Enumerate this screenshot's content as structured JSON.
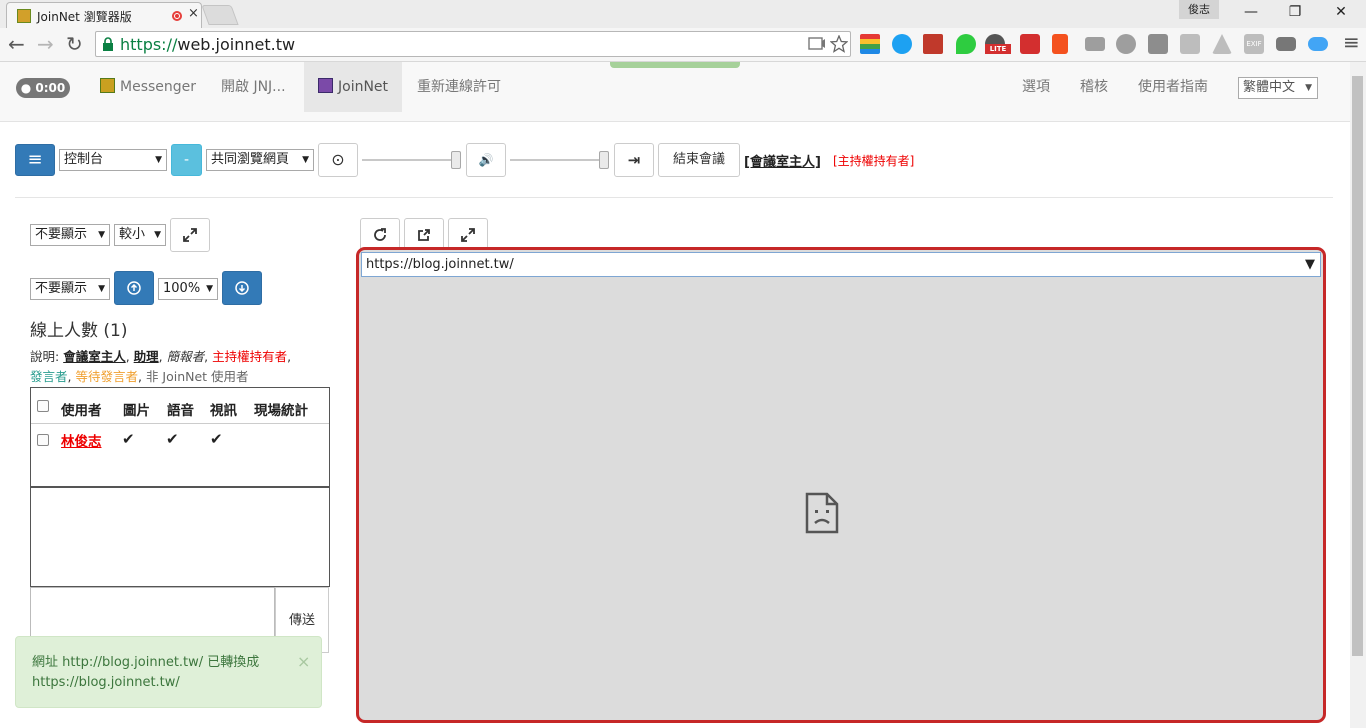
{
  "browser": {
    "tab_title": "JoinNet 瀏覽器版",
    "tab_close": "×",
    "user_chip": "俊志",
    "window_buttons": {
      "minimize": "—",
      "restore": "❐",
      "close": "✕"
    },
    "nav": {
      "back": "←",
      "forward": "→",
      "reload": "↻",
      "menu": "≡"
    },
    "url_scheme": "https://",
    "url_host": "web.joinnet.tw",
    "extensions": [
      "cast-icon",
      "star-icon",
      "colors-icon",
      "skype-icon",
      "book-icon",
      "evernote-icon",
      "lite-icon",
      "adobe-icon",
      "office-icon",
      "chat-icon",
      "m-icon",
      "s-icon",
      "tower-icon",
      "drive-icon",
      "exif-icon",
      "glasses-icon",
      "cloud-icon"
    ],
    "extension_exif": "EXIF",
    "extension_lite": "LITE"
  },
  "app_nav": {
    "timer": "0:00",
    "links": [
      "Messenger",
      "開啟 JNJ...",
      "JoinNet",
      "重新連線許可"
    ],
    "right_links": [
      "選項",
      "稽核",
      "使用者指南"
    ],
    "language": "繁體中文"
  },
  "controls": {
    "menu_icon": "≡",
    "console_select": "控制台",
    "minus_button": "-",
    "cobrowse_select": "共同瀏覽網頁",
    "record_icon": "⊙",
    "volume_icon": "🔊",
    "exit_icon": "⇥",
    "end_meeting": "結束會議",
    "host_label": "[會議室主人]",
    "holder_label": "[主持權持有者]"
  },
  "left_panel": {
    "display_select_1": "不要顯示",
    "size_select": "較小",
    "display_select_2": "不要顯示",
    "zoom_select": "100%",
    "online_title": "線上人數 (1)",
    "legend": {
      "prefix": "說明: ",
      "host": "會議室主人",
      "assistant": "助理",
      "reporter": "簡報者",
      "holder": "主持權持有者",
      "speaker": "發言者",
      "waiting": "等待發言者",
      "non_user": "非 JoinNet 使用者",
      "sep": ", "
    },
    "table_headers": [
      "使用者",
      "圖片",
      "語音",
      "視訊",
      "現場統計"
    ],
    "users": [
      {
        "name": "林俊志",
        "picture": "✔",
        "voice": "✔",
        "video": "✔"
      }
    ],
    "send_button": "傳送"
  },
  "toast": {
    "message": "網址 http://blog.joinnet.tw/ 已轉換成 https://blog.joinnet.tw/",
    "close": "×"
  },
  "main": {
    "url": "https://blog.joinnet.tw/",
    "dropdown_caret": "▼"
  },
  "colors": {
    "primary": "#337ab7",
    "info": "#5bc0de",
    "highlight_border": "#c62828",
    "holder_red": "#e00000",
    "speaker_teal": "#2a9d8f",
    "waiting_orange": "#f0a030",
    "toast_bg": "#dff0d8"
  }
}
